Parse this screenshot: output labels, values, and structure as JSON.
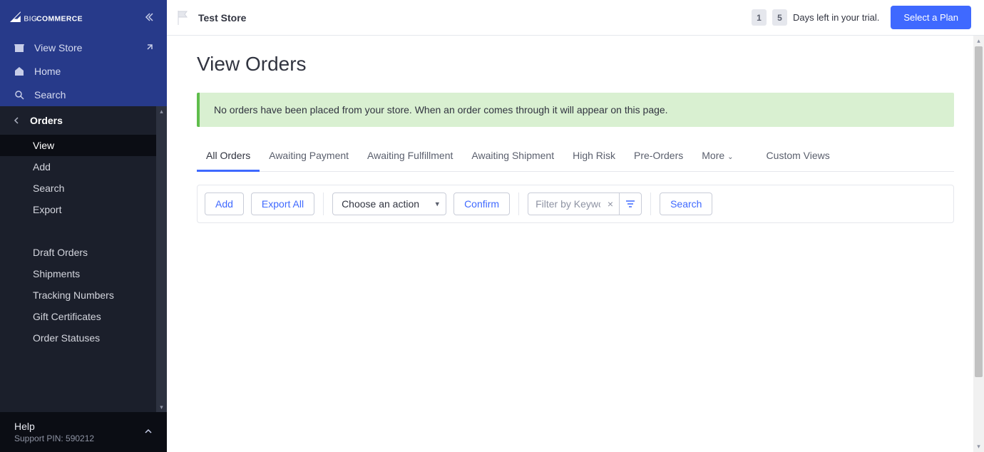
{
  "header": {
    "store_name": "Test Store",
    "trial_day1": "1",
    "trial_day2": "5",
    "trial_text": "Days left in your trial.",
    "select_plan": "Select a Plan"
  },
  "sidebar": {
    "view_store": "View Store",
    "home": "Home",
    "search": "Search",
    "section_title": "Orders",
    "items": {
      "view": "View",
      "add": "Add",
      "search": "Search",
      "export": "Export",
      "draft": "Draft Orders",
      "shipments": "Shipments",
      "tracking": "Tracking Numbers",
      "gift": "Gift Certificates",
      "statuses": "Order Statuses"
    },
    "help_title": "Help",
    "help_sub": "Support PIN: 590212"
  },
  "page": {
    "title": "View Orders",
    "alert": "No orders have been placed from your store. When an order comes through it will appear on this page.",
    "tabs": {
      "all": "All Orders",
      "payment": "Awaiting Payment",
      "fulfillment": "Awaiting Fulfillment",
      "shipment": "Awaiting Shipment",
      "risk": "High Risk",
      "pre": "Pre-Orders",
      "more": "More",
      "custom": "Custom Views"
    },
    "toolbar": {
      "add": "Add",
      "export_all": "Export All",
      "action_select": "Choose an action",
      "confirm": "Confirm",
      "filter_placeholder": "Filter by Keyword",
      "search": "Search"
    }
  }
}
